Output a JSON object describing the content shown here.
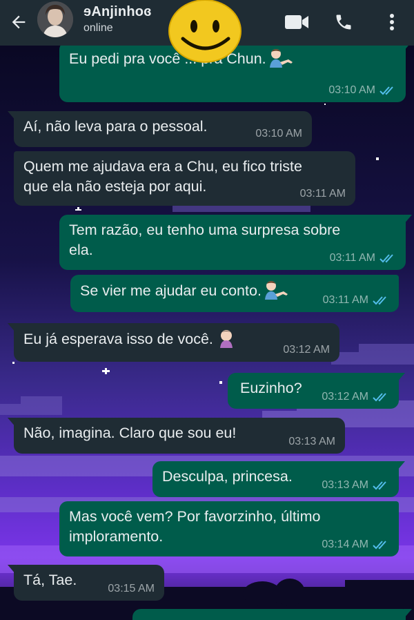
{
  "header": {
    "contact_name": "ɘAnjinhoɞ",
    "status": "online",
    "icons": [
      "back-arrow-icon",
      "video-call-icon",
      "phone-call-icon",
      "more-options-icon"
    ]
  },
  "colors": {
    "header_bg": "#1f2c34",
    "incoming_bubble": "#1f2c34",
    "outgoing_bubble": "#005c4b",
    "read_ticks": "#53bdeb",
    "sticker_yellow": "#f2c81f"
  },
  "messages": [
    {
      "side": "out",
      "text": "Eu pedi pra você ... pra Chun.",
      "emoji": "man-tipping-hand",
      "time": "03:10 AM",
      "read": true
    },
    {
      "side": "in",
      "text": "Aí, não leva para o pessoal.",
      "time": "03:10 AM"
    },
    {
      "side": "in",
      "text": "Quem me ajudava era a Chu, eu fico triste\nque ela não esteja por aqui.",
      "time": "03:11 AM"
    },
    {
      "side": "out",
      "text": "Tem razão, eu tenho uma surpresa sobre\nela.",
      "time": "03:11 AM",
      "read": true
    },
    {
      "side": "out",
      "text": "Se vier me ajudar eu conto.",
      "emoji": "man-tipping-hand",
      "time": "03:11 AM",
      "read": true
    },
    {
      "side": "in",
      "text": "Eu já esperava isso de você.",
      "emoji": "woman-facepalming",
      "time": "03:12 AM"
    },
    {
      "side": "out",
      "text": "Euzinho?",
      "time": "03:12 AM",
      "read": true
    },
    {
      "side": "in",
      "text": "Não, imagina. Claro que sou eu!",
      "time": "03:13 AM"
    },
    {
      "side": "out",
      "text": "Desculpa, princesa.",
      "time": "03:13 AM",
      "read": true
    },
    {
      "side": "out",
      "text": "Mas você vem? Por favorzinho, último\nimploramento.",
      "time": "03:14 AM",
      "read": true
    },
    {
      "side": "in",
      "text": "Tá, Tae.",
      "time": "03:15 AM"
    }
  ]
}
